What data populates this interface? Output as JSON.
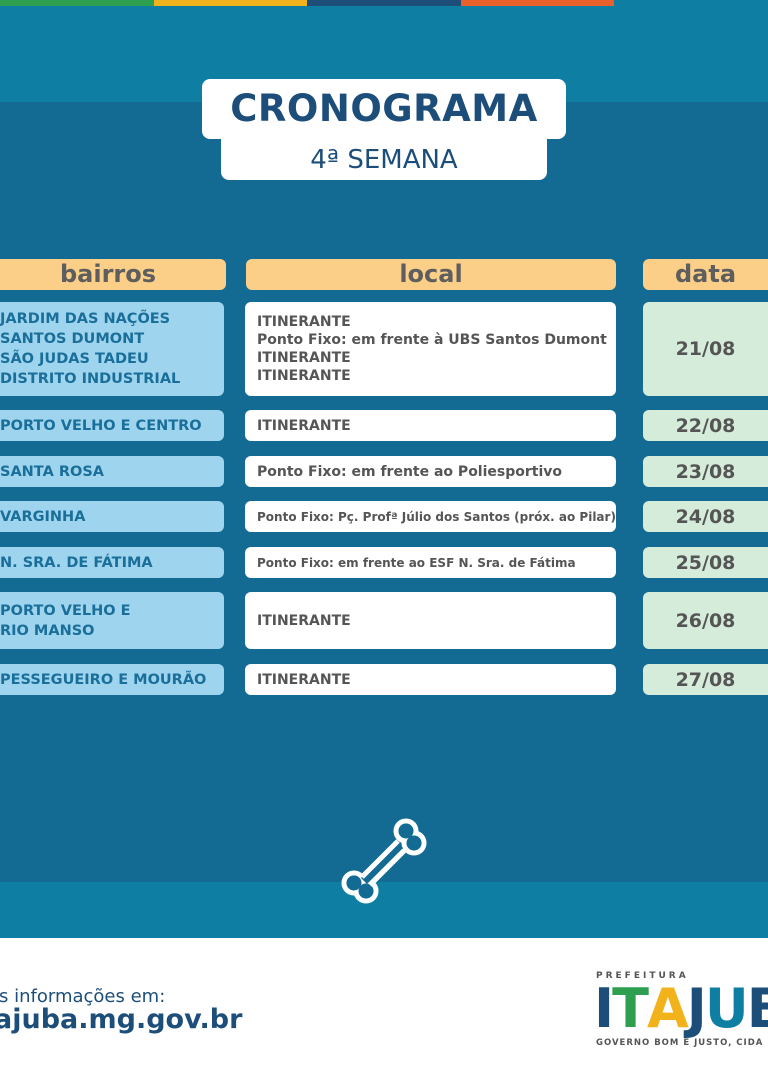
{
  "header": {
    "title": "CRONOGRAMA",
    "subtitle": "4ª SEMANA"
  },
  "table": {
    "columns": [
      "bairros",
      "local",
      "data"
    ],
    "rows": [
      {
        "bairros": [
          "JARDIM DAS NAÇÕES",
          "SANTOS DUMONT",
          "SÃO JUDAS TADEU",
          "DISTRITO INDUSTRIAL"
        ],
        "local": [
          "ITINERANTE",
          "Ponto Fixo: em frente à UBS Santos Dumont",
          "ITINERANTE",
          "ITINERANTE"
        ],
        "data": "21/08"
      },
      {
        "bairros": [
          "PORTO VELHO E CENTRO"
        ],
        "local": [
          "ITINERANTE"
        ],
        "data": "22/08"
      },
      {
        "bairros": [
          "SANTA ROSA"
        ],
        "local": [
          "Ponto Fixo: em frente ao Poliesportivo"
        ],
        "data": "23/08"
      },
      {
        "bairros": [
          "VARGINHA"
        ],
        "local": [
          "Ponto Fixo: Pç. Profª Júlio dos Santos (próx. ao Pilar)"
        ],
        "data": "24/08"
      },
      {
        "bairros": [
          "N. SRA. DE FÁTIMA"
        ],
        "local": [
          "Ponto Fixo: em frente ao ESF N. Sra. de Fátima"
        ],
        "data": "25/08"
      },
      {
        "bairros": [
          "PORTO VELHO E",
          "RIO MANSO"
        ],
        "local": [
          "ITINERANTE"
        ],
        "data": "26/08"
      },
      {
        "bairros": [
          "PESSEGUEIRO E MOURÃO"
        ],
        "local": [
          "ITINERANTE"
        ],
        "data": "27/08"
      }
    ]
  },
  "icon": "bone-icon",
  "footer": {
    "info_label": "is informações em:",
    "url": "ajuba.mg.gov.br"
  },
  "logo": {
    "top": "PREFEITURA",
    "word_letters": [
      "I",
      "T",
      "A",
      "J",
      "U",
      "B"
    ],
    "tagline": "GOVERNO BOM E JUSTO, CIDA"
  },
  "colors": {
    "stripe_green": "#2e9e4f",
    "stripe_yellow": "#f2b21b",
    "stripe_blue": "#1d4e7a",
    "stripe_orange": "#e8602a",
    "stripe_teal": "#0f7ea3",
    "bg_dark": "#136b94",
    "bg_light": "#0f7ea3",
    "header_orange": "#fbcf87",
    "cell_blue": "#9ed4ed",
    "cell_green": "#d5ecdb",
    "title_navy": "#1d4e7a"
  }
}
